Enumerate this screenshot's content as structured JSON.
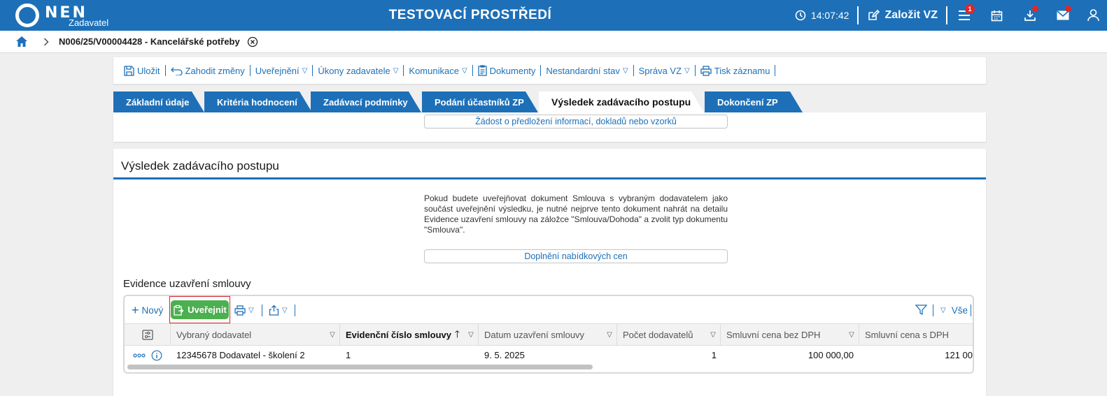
{
  "header": {
    "logo_text": "NEN",
    "logo_subtitle": "Zadavatel",
    "environment_title": "TESTOVACÍ PROSTŘEDÍ",
    "time": "14:07:42",
    "create_vz_label": "Založit VZ",
    "menu_badge": "1"
  },
  "breadcrumb": {
    "current": "N006/25/V00004428 - Kancelářské potřeby"
  },
  "toolbar": {
    "save": "Uložit",
    "discard": "Zahodit změny",
    "publish": "Uveřejnění",
    "actions": "Úkony zadavatele",
    "communication": "Komunikace",
    "documents": "Dokumenty",
    "nonstandard": "Nestandardní stav",
    "management": "Správa VZ",
    "print": "Tisk záznamu"
  },
  "tabs": [
    {
      "label": "Základní údaje"
    },
    {
      "label": "Kritéria hodnocení"
    },
    {
      "label": "Zadávací podmínky"
    },
    {
      "label": "Podání účastníků ZP"
    },
    {
      "label": "Výsledek zadávacího postupu",
      "active": true
    },
    {
      "label": "Dokončení ZP"
    }
  ],
  "request_button": "Žádost o předložení informací, dokladů nebo vzorků",
  "result": {
    "title": "Výsledek zadávacího postupu",
    "info_text": "Pokud budete uveřejňovat dokument Smlouva s vybraným dodavatelem jako součást uveřejnění výsledku, je nutné nejprve tento dokument nahrát na detailu Evidence uzavření smlouvy na záložce \"Smlouva/Dohoda\" a zvolit typ dokumentu \"Smlouva\".",
    "price_button": "Doplnění nabídkových cen",
    "section_title": "Evidence uzavření smlouvy"
  },
  "grid": {
    "new_label": "Nový",
    "publish_label": "Uveřejnit",
    "all_label": "Vše",
    "columns": [
      "Vybraný dodavatel",
      "Evidenční číslo smlouvy",
      "Datum uzavření smlouvy",
      "Počet dodavatelů",
      "Smluvní cena bez DPH",
      "Smluvní cena s DPH"
    ],
    "rows": [
      [
        "12345678 Dodavatel - školení 2",
        "1",
        "9. 5. 2025",
        "1",
        "100 000,00",
        "121 00"
      ]
    ]
  },
  "colors": {
    "primary": "#1d70b8",
    "publish_green": "#4caf50",
    "highlight_red": "#d9232a",
    "badge_red": "#e0262b"
  }
}
